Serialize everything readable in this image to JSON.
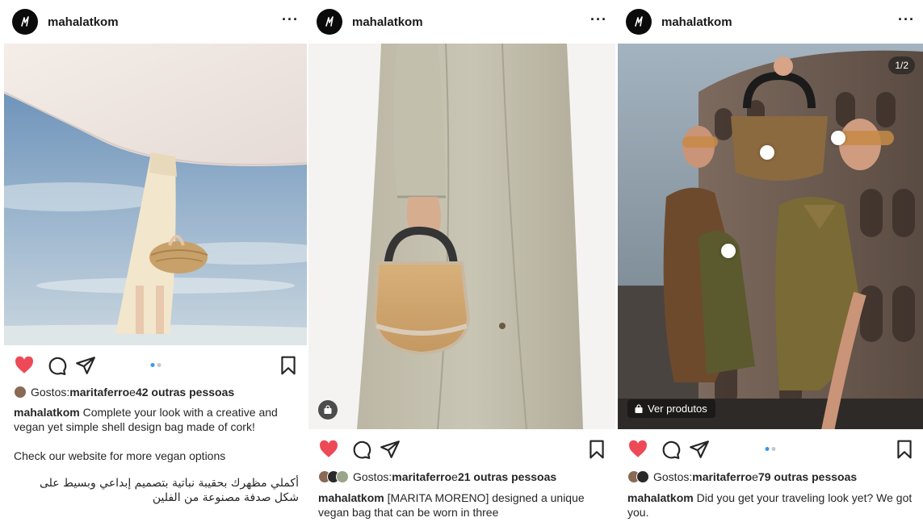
{
  "posts": [
    {
      "username": "mahalatkom",
      "more_label": "···",
      "liked_by": "maritaferro",
      "likes_prefix": "Gostos: ",
      "likes_joiner": " e ",
      "likes_others": "42 outras pessoas",
      "caption_user": "mahalatkom",
      "caption_text": " Complete your look with a creative and vegan yet simple shell design bag made of cork!",
      "caption_para": "Check our website for more vegan options",
      "caption_arabic": "أكملي مظهرك بحقيبة نباتية بتصميم إبداعي وبسيط على شكل صدفة مصنوعة من الفلين",
      "carousel_dots": 2,
      "carousel_active": 1
    },
    {
      "username": "mahalatkom",
      "more_label": "···",
      "liked_by": "maritaferro",
      "likes_prefix": "Gostos: ",
      "likes_joiner": " e ",
      "likes_others": "21 outras pessoas",
      "caption_user": "mahalatkom",
      "caption_text": " [MARITA MORENO] designed a unique vegan bag that can be worn in three"
    },
    {
      "username": "mahalatkom",
      "more_label": "···",
      "liked_by": "maritaferro",
      "likes_prefix": "Gostos: ",
      "likes_joiner": " e ",
      "likes_others": "79 outras pessoas",
      "caption_user": "mahalatkom",
      "caption_text": " Did you get your traveling look yet? We got you.",
      "counter": "1/2",
      "shop_label": "Ver produtos",
      "carousel_dots": 2,
      "carousel_active": 1
    }
  ],
  "colors": {
    "like_red": "#ed4956",
    "text": "#262626",
    "dot_active": "#3897f0",
    "dot_inactive": "#c7c7c7"
  },
  "icons": [
    "logo-icon",
    "more-icon",
    "heart-icon",
    "comment-icon",
    "share-icon",
    "bookmark-icon",
    "shopping-bag-icon"
  ]
}
